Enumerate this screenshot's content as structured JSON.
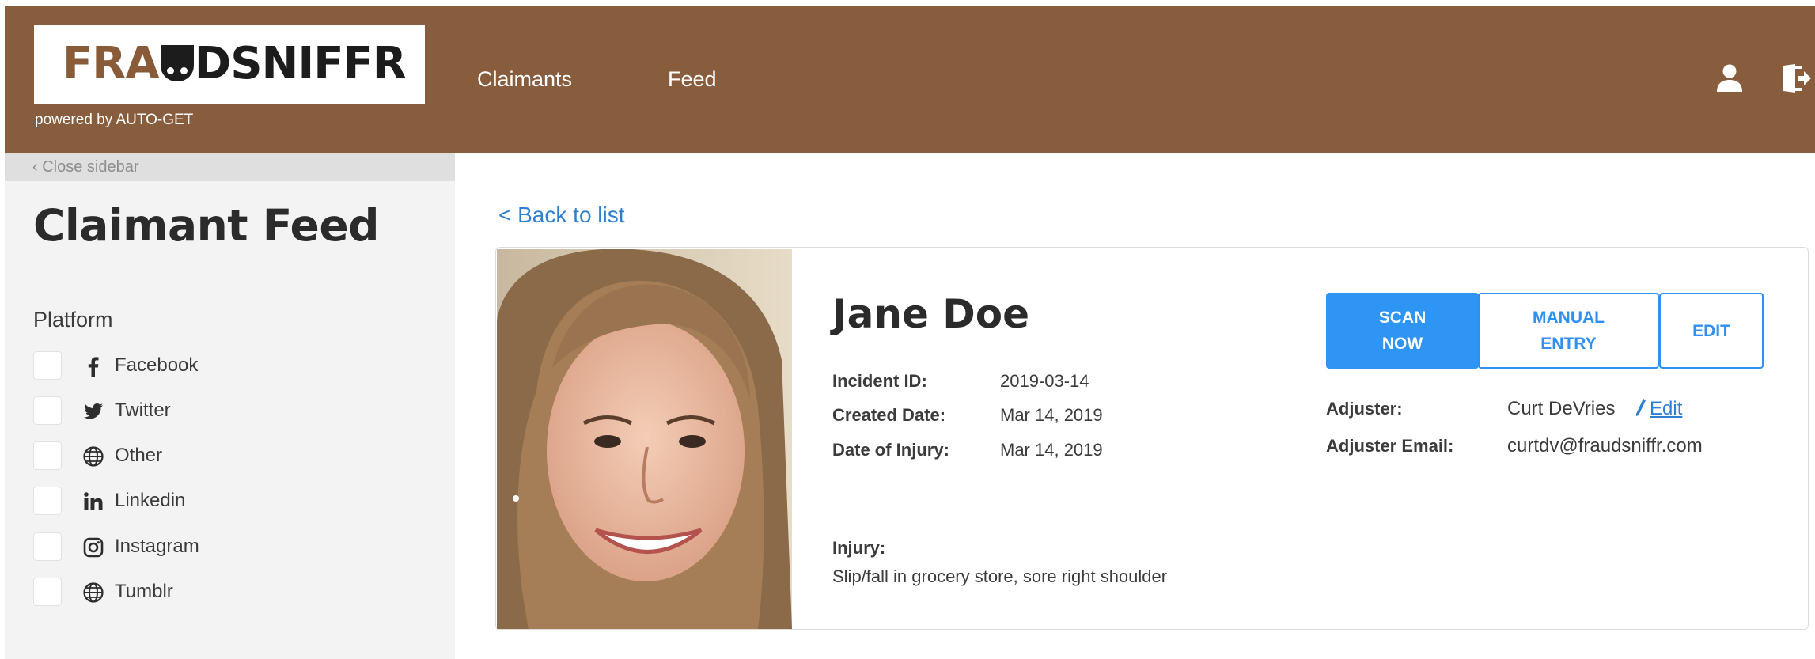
{
  "header": {
    "logo": {
      "part1": "FRA",
      "part2": "DSNIFFR"
    },
    "powered_by": "powered by AUTO-GET",
    "nav": [
      {
        "label": "Claimants"
      },
      {
        "label": "Feed"
      }
    ],
    "icons": {
      "user": "user-icon",
      "logout": "logout-icon"
    },
    "background_color": "#875d3e"
  },
  "sidebar": {
    "close_label": "‹ Close sidebar",
    "title": "Claimant Feed",
    "platform_label": "Platform",
    "platforms": [
      {
        "label": "Facebook",
        "icon": "facebook-icon",
        "checked": false
      },
      {
        "label": "Twitter",
        "icon": "twitter-icon",
        "checked": false
      },
      {
        "label": "Other",
        "icon": "globe-icon",
        "checked": false
      },
      {
        "label": "Linkedin",
        "icon": "linkedin-icon",
        "checked": false
      },
      {
        "label": "Instagram",
        "icon": "instagram-icon",
        "checked": false
      },
      {
        "label": "Tumblr",
        "icon": "globe-icon",
        "checked": false
      }
    ]
  },
  "main": {
    "back_label": "< Back to list",
    "claimant": {
      "name": "Jane Doe",
      "incident_id_label": "Incident ID:",
      "incident_id": "2019-03-14",
      "created_label": "Created Date:",
      "created": "Mar 14, 2019",
      "injury_date_label": "Date of Injury:",
      "injury_date": "Mar 14, 2019",
      "injury_label": "Injury:",
      "injury": "Slip/fall in grocery store, sore right shoulder",
      "adjuster_label": "Adjuster:",
      "adjuster": "Curt DeVries",
      "adjuster_edit": "Edit",
      "adjuster_email_label": "Adjuster Email:",
      "adjuster_email": "curtdv@fraudsniffr.com"
    },
    "buttons": {
      "scan_line1": "SCAN",
      "scan_line2": "NOW",
      "manual_line1": "MANUAL",
      "manual_line2": "ENTRY",
      "edit": "EDIT"
    },
    "accent_color": "#2e95f4"
  }
}
